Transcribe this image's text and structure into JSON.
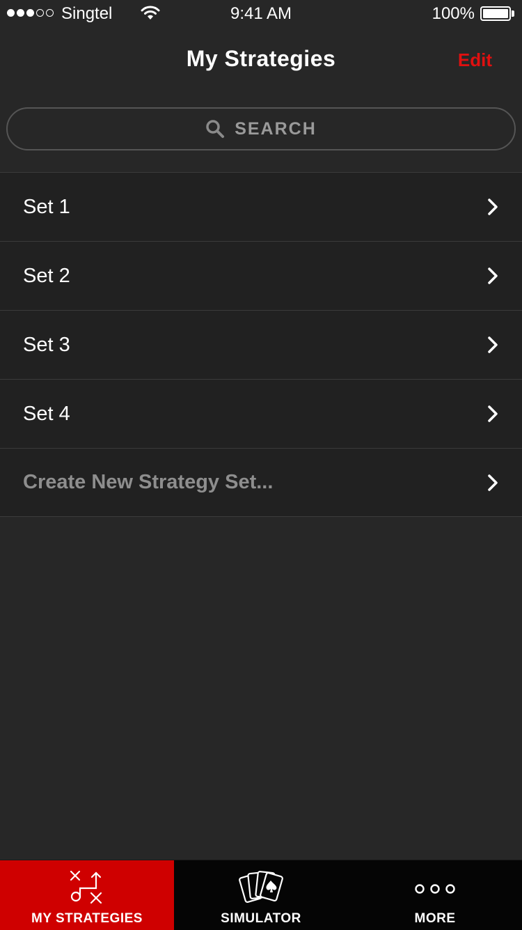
{
  "status_bar": {
    "carrier": "Singtel",
    "time": "9:41 AM",
    "battery": "100%"
  },
  "nav": {
    "title": "My Strategies",
    "edit_label": "Edit",
    "accent_color": "#e01010"
  },
  "search": {
    "placeholder": "SEARCH"
  },
  "list": {
    "items": [
      {
        "label": "Set 1"
      },
      {
        "label": "Set 2"
      },
      {
        "label": "Set 3"
      },
      {
        "label": "Set 4"
      },
      {
        "label": "Create New Strategy Set..."
      }
    ]
  },
  "tab_bar": {
    "tabs": [
      {
        "label": "MY STRATEGIES",
        "icon": "play-diagram-icon",
        "active": true
      },
      {
        "label": "SIMULATOR",
        "icon": "playing-cards-icon",
        "active": false
      },
      {
        "label": "MORE",
        "icon": "more-dots-icon",
        "active": false
      }
    ],
    "active_color": "#cf0000"
  }
}
